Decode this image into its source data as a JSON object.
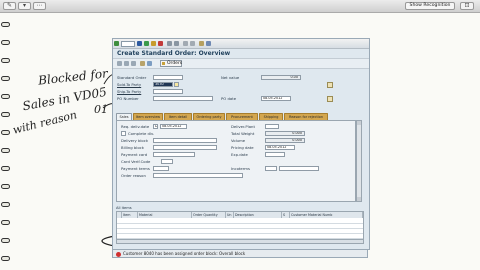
{
  "toolbar": {
    "show_recognition": "Show Recognition"
  },
  "sap": {
    "title": "Create Standard Order: Overview",
    "orders_button": "Orders",
    "header": {
      "standard_order_label": "Standard Order",
      "sold_to_label": "Sold-To Party",
      "sold_to_value": "3030",
      "ship_to_label": "Ship-To Party",
      "po_number_label": "PO Number",
      "net_value_label": "Net value",
      "net_value": "0.00",
      "po_date_label": "PO date",
      "po_date": "08.05.2012"
    },
    "tabs": [
      "Sales",
      "Item overview",
      "Item detail",
      "Ordering party",
      "Procurement",
      "Shipping",
      "Reason for rejection"
    ],
    "sales": {
      "req_deliv_date_label": "Req. deliv.date",
      "req_deliv_date_prefix": "D",
      "req_deliv_date": "08.05.2012",
      "complete_dlv_label": "Complete dlv.",
      "delivery_block_label": "Delivery block",
      "billing_block_label": "Billing block",
      "payment_card_label": "Payment card",
      "card_verif_label": "Card Verif.Code",
      "payment_terms_label": "Payment terms",
      "order_reason_label": "Order reason",
      "deliver_plant_label": "Deliver.Plant",
      "total_weight_label": "Total Weight",
      "total_weight": "0.000",
      "volume_label": "Volume",
      "volume": "0.000",
      "pricing_date_label": "Pricing date",
      "pricing_date": "08.05.2012",
      "exp_date_label": "Exp.date",
      "incoterms_label": "Incoterms"
    },
    "items": {
      "title": "All items",
      "columns": [
        "Item",
        "Material",
        "Order Quantity",
        "Un",
        "Description",
        "S",
        "Customer Material Numb"
      ]
    },
    "status_message": "Customer 8040 has been assigned order block: Overall block"
  },
  "annotations": {
    "line1": "Blocked for",
    "line2": "Sales in VD05",
    "line3": "with reason",
    "line4": "01"
  }
}
